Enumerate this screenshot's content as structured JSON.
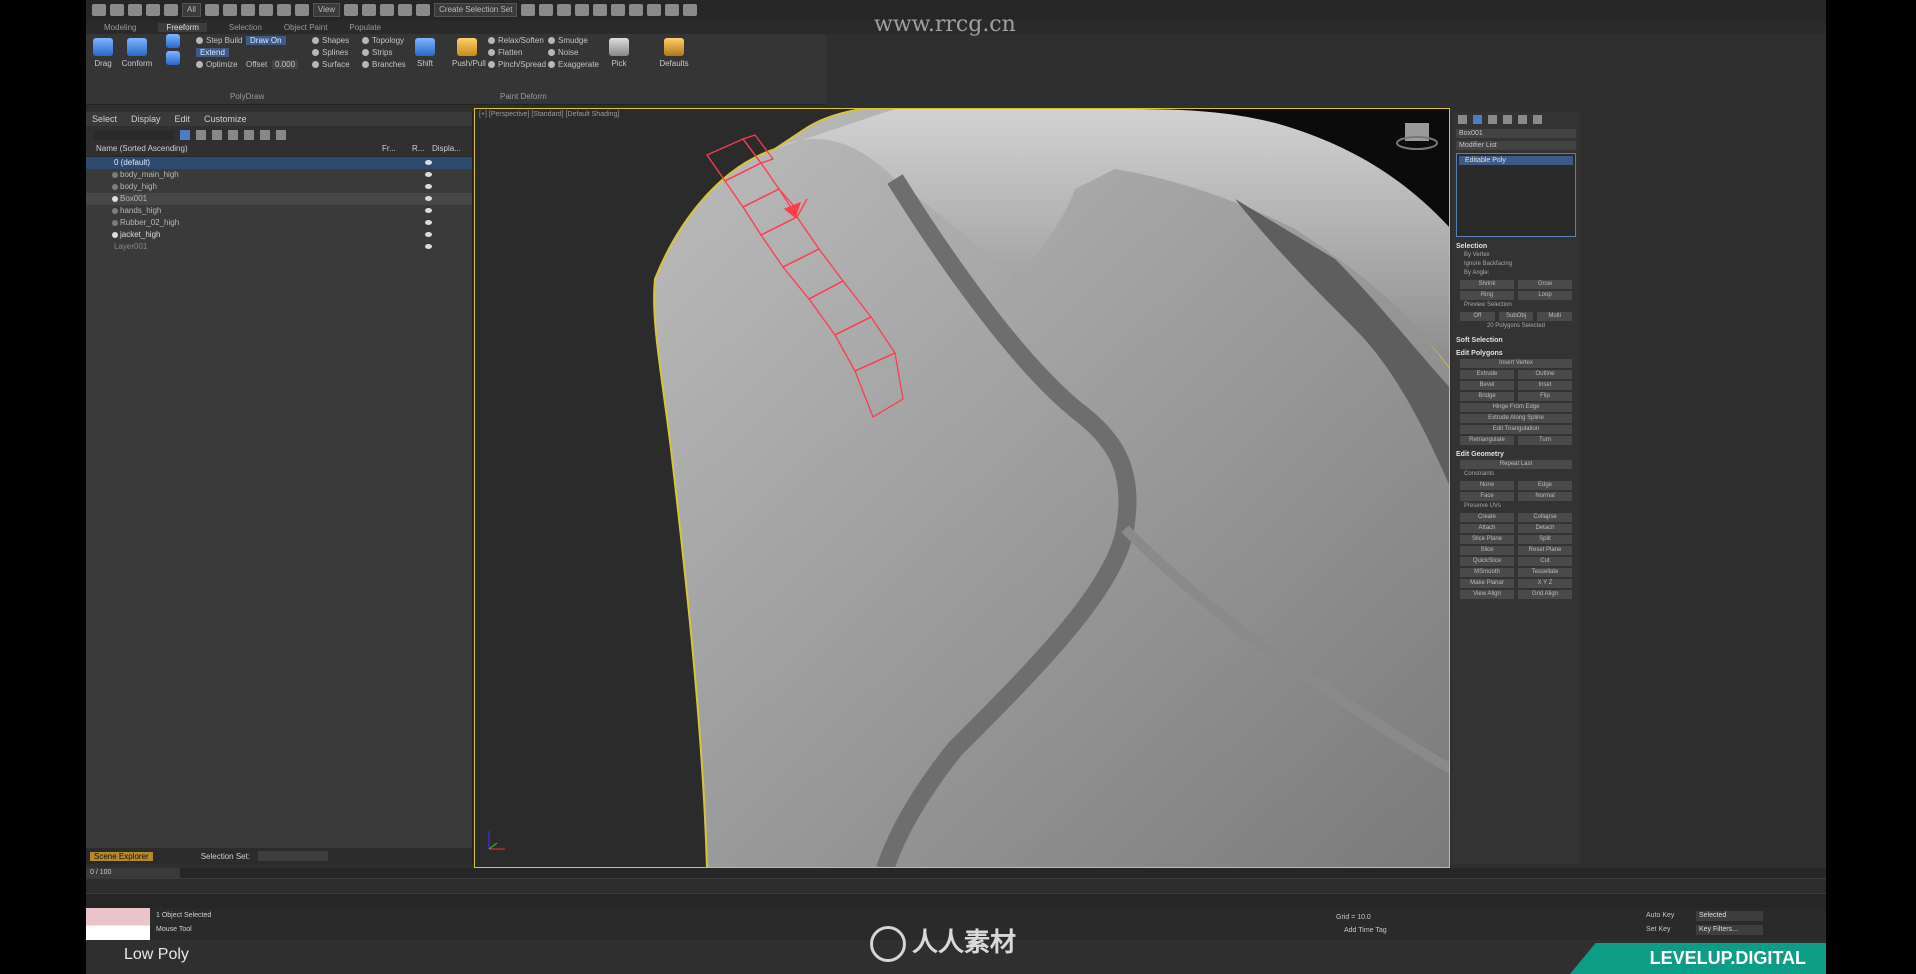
{
  "toolbar": {
    "workspace": "Create Selection Set",
    "view_dropdown": "All",
    "ref_dropdown": "View"
  },
  "tabs": [
    "Modeling",
    "Freeform",
    "Selection",
    "Object Paint",
    "Populate"
  ],
  "tabs_active": "Freeform",
  "ribbon": {
    "drag": "Drag",
    "conform": "Conform",
    "step_build": "Step Build",
    "extend": "Extend",
    "optimize": "Optimize",
    "draw_on": "Draw On",
    "offset_label": "Offset",
    "offset_value": "0.000",
    "shapes": "Shapes",
    "splines": "Splines",
    "surface": "Surface",
    "topology": "Topology",
    "strips": "Strips",
    "branches": "Branches",
    "shift": "Shift",
    "push_pull": "Push/Pull",
    "relax_soften": "Relax/Soften",
    "flatten": "Flatten",
    "pinch_spread": "Pinch/Spread",
    "smudge": "Smudge",
    "noise": "Noise",
    "exaggerate": "Exaggerate",
    "pick": "Pick",
    "defaults": "Defaults",
    "group_polydraw": "PolyDraw",
    "group_paint_deform": "Paint Deform"
  },
  "explorer": {
    "menu": [
      "Select",
      "Display",
      "Edit",
      "Customize"
    ],
    "header": "Name (Sorted Ascending)",
    "col_fr": "Fr...",
    "col_r": "R...",
    "col_disp": "Displa...",
    "rows": [
      "0 (default)",
      "body_main_high",
      "body_high",
      "Box001",
      "hands_high",
      "Rubber_02_high",
      "jacket_high",
      "Layer001"
    ],
    "scene_explorer": "Scene Explorer",
    "selection_set": "Selection Set:"
  },
  "viewport": {
    "label": "[+] [Perspective] [Standard] [Default Shading]"
  },
  "command_panel": {
    "object_name": "Box001",
    "modifier_list": "Modifier List",
    "stack_item": "Editable Poly",
    "selection": "Selection",
    "by_vertex": "By Vertex",
    "ignore_backfacing": "Ignore Backfacing",
    "by_angle": "By Angle:",
    "shrink": "Shrink",
    "grow": "Grow",
    "ring": "Ring",
    "loop": "Loop",
    "preview_selection": "Preview Selection",
    "off": "Off",
    "subobj": "SubObj",
    "multi": "Multi",
    "polys_selected": "20 Polygons Selected",
    "soft_selection": "Soft Selection",
    "edit_polygons": "Edit Polygons",
    "insert_vertex": "Insert Vertex",
    "extrude": "Extrude",
    "outline": "Outline",
    "bevel": "Bevel",
    "inset": "Inset",
    "bridge": "Bridge",
    "flip": "Flip",
    "hinge": "Hinge From Edge",
    "extrude_spline": "Extrude Along Spline",
    "edit_tri": "Edit Triangulation",
    "retriangulate": "Retriangulate",
    "turn": "Turn",
    "edit_geometry": "Edit Geometry",
    "repeat_last": "Repeat Last",
    "constraints": "Constraints",
    "none": "None",
    "edge": "Edge",
    "face": "Face",
    "normal": "Normal",
    "preserve_uvs": "Preserve UVs",
    "create": "Create",
    "collapse": "Collapse",
    "attach": "Attach",
    "detach": "Detach",
    "slice_plane": "Slice Plane",
    "split": "Split",
    "slice": "Slice",
    "reset_plane": "Reset Plane",
    "quickslice": "QuickSlice",
    "cut": "Cut",
    "msmooth": "MSmooth",
    "tessellate": "Tessellate",
    "make_planar": "Make Planar",
    "xyz": "X  Y  Z",
    "view_align": "View Align",
    "grid_align": "Grid Align"
  },
  "timeline": {
    "frame": "0 / 100"
  },
  "status": {
    "objects_selected": "1 Object Selected",
    "tool": "Mouse Tool",
    "grid": "Grid = 10.0",
    "add_time_tag": "Add Time Tag",
    "auto_key": "Auto Key",
    "set_key": "Set Key",
    "selected": "Selected",
    "key_filters": "Key Filters..."
  },
  "caption": "Low Poly",
  "brand": "LEVELUP.DIGITAL",
  "watermark_top": "www.rrcg.cn",
  "watermark_bottom": "人人素材"
}
